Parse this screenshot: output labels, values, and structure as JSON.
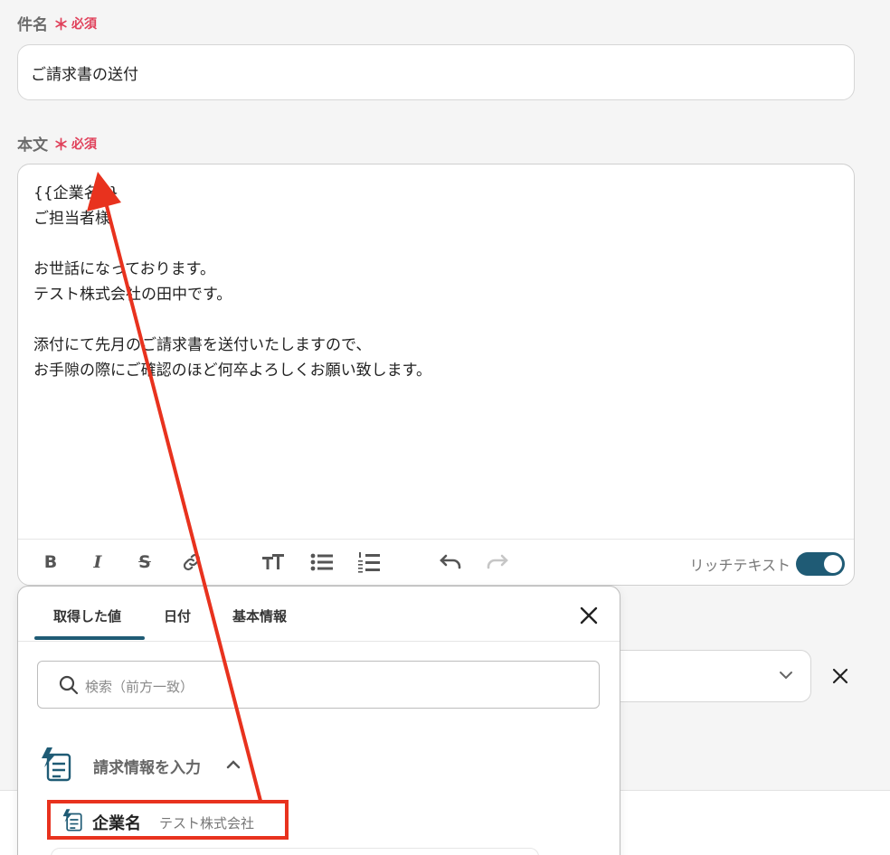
{
  "subject": {
    "label": "件名",
    "required_mark": "＊",
    "required_text": "必須",
    "value": "ご請求書の送付"
  },
  "body": {
    "label": "本文",
    "required_mark": "＊",
    "required_text": "必須",
    "lines": [
      "{{企業名}}",
      "ご担当者様",
      "",
      "お世話になっております。",
      "テスト株式会社の田中です。",
      "",
      "添付にて先月のご請求書を送付いたしますので、",
      "お手隙の際にご確認のほど何卒よろしくお願い致します。"
    ]
  },
  "toolbar": {
    "bold_label": "B",
    "italic_label": "I",
    "strike_label": "S",
    "rich_text_label": "リッチテキスト",
    "rich_text_enabled": true,
    "icons": [
      "bold-icon",
      "italic-icon",
      "strikethrough-icon",
      "link-icon",
      "text-size-icon",
      "bullet-list-icon",
      "numbered-list-icon",
      "undo-icon",
      "redo-icon"
    ]
  },
  "picker": {
    "tabs": [
      "取得した値",
      "日付",
      "基本情報"
    ],
    "active_tab": "取得した値",
    "search_placeholder": "検索（前方一致）",
    "group": {
      "label": "請求情報を入力",
      "expanded": true
    },
    "item": {
      "label": "企業名",
      "value": "テスト株式会社"
    }
  },
  "colors": {
    "accent": "#1f5b75",
    "required": "#e0405a",
    "annotation": "#e8321e"
  }
}
